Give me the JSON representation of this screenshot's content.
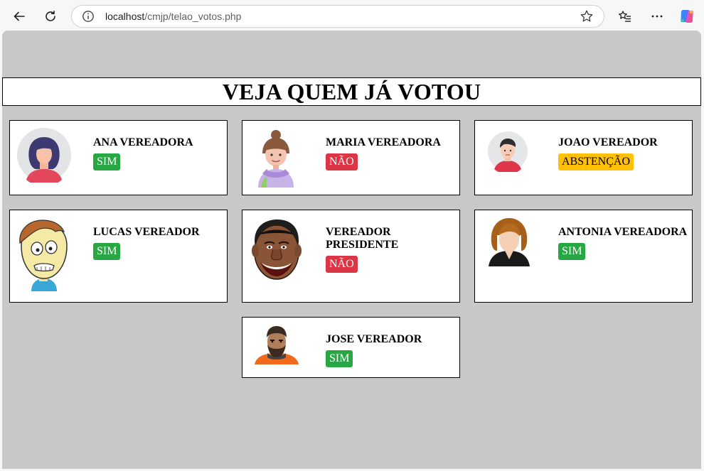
{
  "browser": {
    "url_host": "localhost",
    "url_path": "/cmjp/telao_votos.php"
  },
  "page": {
    "title": "VEJA QUEM JÁ VOTOU"
  },
  "colors": {
    "sim": "#28a745",
    "nao": "#dc3545",
    "abstencao": "#ffc107",
    "page_background": "#c8c8c8"
  },
  "councilors": [
    {
      "name": "ANA VEREADORA",
      "vote": "SIM",
      "vote_type": "sim",
      "avatar": "woman-avatar-icon"
    },
    {
      "name": "MARIA VEREADORA",
      "vote": "NÃO",
      "vote_type": "nao",
      "avatar": "girl-hoodie-avatar-icon"
    },
    {
      "name": "JOAO VEREADOR",
      "vote": "ABSTENÇÃO",
      "vote_type": "abs",
      "avatar": "man-avatar-icon"
    },
    {
      "name": "LUCAS VEREADOR",
      "vote": "SIM",
      "vote_type": "sim",
      "avatar": "cartoon-boy-avatar-icon"
    },
    {
      "name": "VEREADOR PRESIDENTE",
      "vote": "NÃO",
      "vote_type": "nao",
      "avatar": "caricature-man-avatar-icon"
    },
    {
      "name": "ANTONIA VEREADORA",
      "vote": "SIM",
      "vote_type": "sim",
      "avatar": "woman-silhouette-avatar-icon"
    },
    {
      "name": "JOSE VEREADOR",
      "vote": "SIM",
      "vote_type": "sim",
      "avatar": "bearded-man-avatar-icon"
    }
  ]
}
